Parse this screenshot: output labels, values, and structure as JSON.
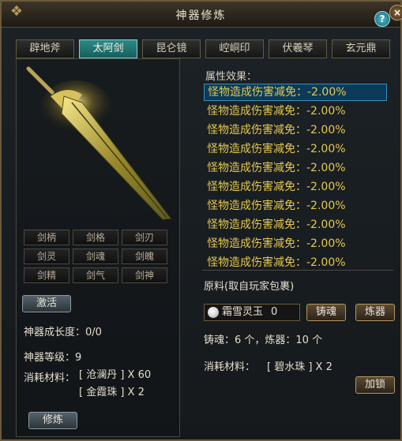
{
  "window": {
    "title": "神器修炼"
  },
  "tabs": [
    {
      "label": "辟地斧",
      "active": false
    },
    {
      "label": "太阿剑",
      "active": true
    },
    {
      "label": "昆仑镜",
      "active": false
    },
    {
      "label": "崆峒印",
      "active": false
    },
    {
      "label": "伏羲琴",
      "active": false
    },
    {
      "label": "玄元鼎",
      "active": false
    }
  ],
  "slots": [
    "剑柄",
    "剑格",
    "剑刃",
    "剑灵",
    "剑魂",
    "剑魄",
    "剑精",
    "剑气",
    "剑神"
  ],
  "left": {
    "activate_label": "激活",
    "growth_label": "神器成长度：0/0",
    "level_label": "神器等级：9",
    "cost_label": "消耗材料：",
    "cost_items": [
      "[ 沧澜丹 ] X 60",
      "[ 金霞珠 ] X 2"
    ],
    "cultivate_label": "修炼"
  },
  "properties": {
    "title": "属性效果：",
    "items": [
      "怪物造成伤害减免：-2.00%",
      "怪物造成伤害减免：-2.00%",
      "怪物造成伤害减免：-2.00%",
      "怪物造成伤害减免：-2.00%",
      "怪物造成伤害减免：-2.00%",
      "怪物造成伤害减免：-2.00%",
      "怪物造成伤害减免：-2.00%",
      "怪物造成伤害减免：-2.00%",
      "怪物造成伤害减免：-2.00%",
      "怪物造成伤害减免：-2.00%"
    ]
  },
  "right": {
    "materials_title": "原料(取自玩家包裹)",
    "material_name": "霜雪灵玉",
    "material_count": "0",
    "forge_soul_label": "铸魂",
    "refine_label": "炼器",
    "counts_label": "铸魂：6 个，炼器：10 个",
    "cost_label": "消耗材料：",
    "cost_item": "[ 碧水珠 ] X 2",
    "lock_label": "加锁"
  },
  "colors": {
    "accent_tab": "#1f7a76",
    "prop_text": "#e6c84f",
    "selected_row": "#0b3b58"
  }
}
